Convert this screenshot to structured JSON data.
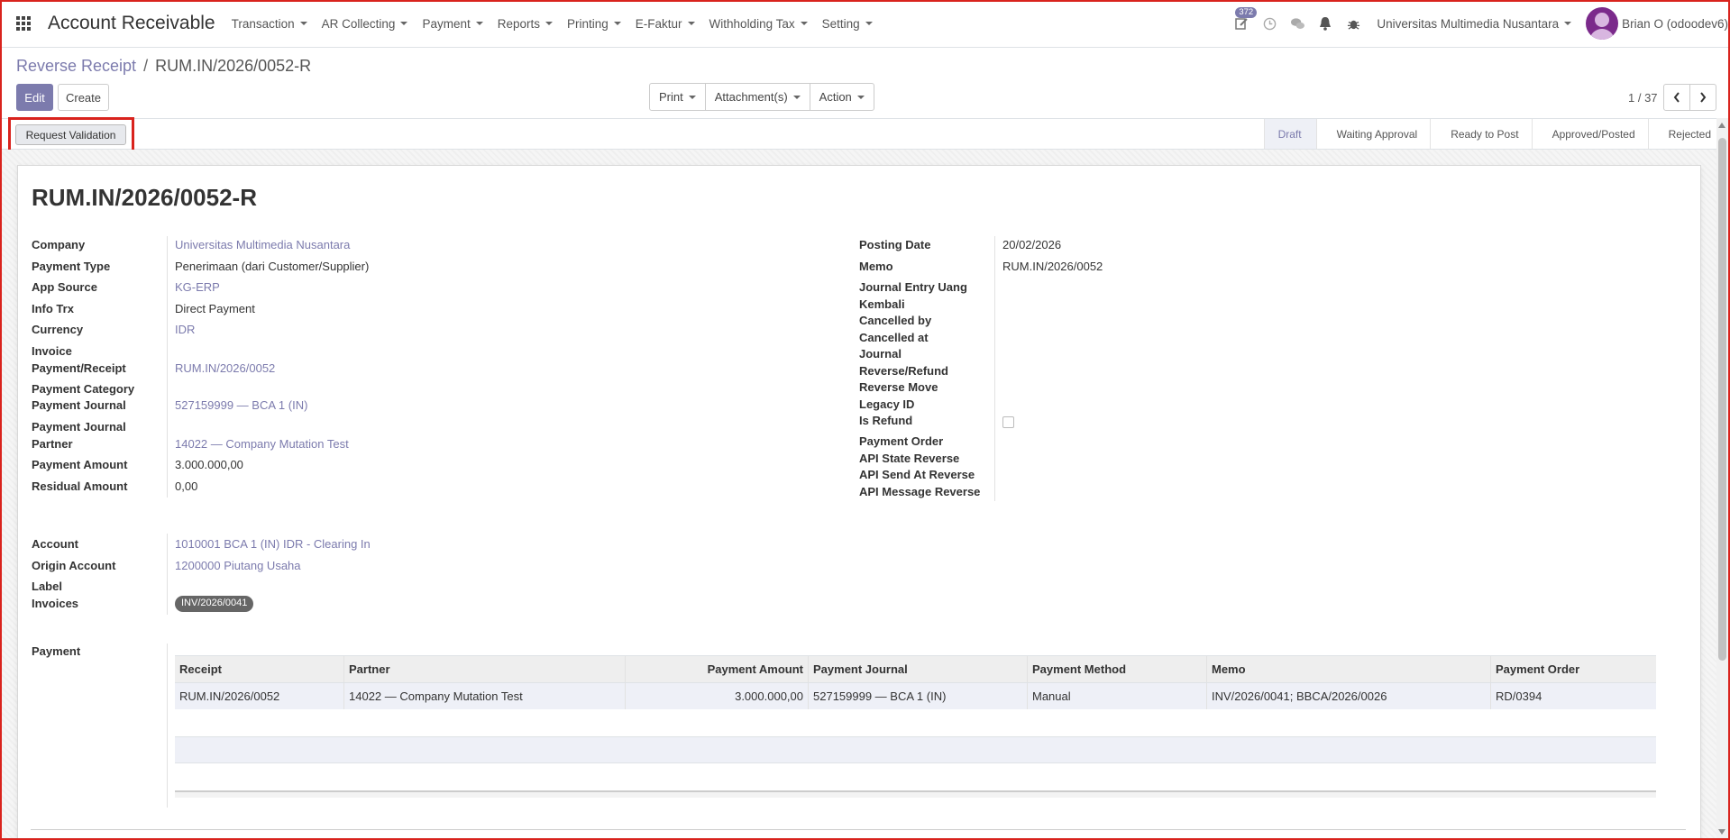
{
  "navbar": {
    "app_title": "Account Receivable",
    "menu": [
      "Transaction",
      "AR Collecting",
      "Payment",
      "Reports",
      "Printing",
      "E-Faktur",
      "Withholding Tax",
      "Setting"
    ],
    "activity_count": "372",
    "company": "Universitas Multimedia Nusantara",
    "user": "Brian O (odoodev6)"
  },
  "control": {
    "breadcrumb_parent": "Reverse Receipt",
    "breadcrumb_sep": "/",
    "breadcrumb_current": "RUM.IN/2026/0052-R",
    "edit_label": "Edit",
    "create_label": "Create",
    "print_label": "Print",
    "attachments_label": "Attachment(s)",
    "action_label": "Action",
    "pager_value": "1 / 37"
  },
  "statusbar": {
    "request_validation": "Request Validation",
    "stages": [
      "Draft",
      "Waiting Approval",
      "Ready to Post",
      "Approved/Posted",
      "Rejected"
    ],
    "active_stage": "Draft"
  },
  "record": {
    "title": "RUM.IN/2026/0052-R",
    "left": [
      {
        "label": "Company",
        "value": "Universitas Multimedia Nusantara",
        "link": true
      },
      {
        "label": "Payment Type",
        "value": "Penerimaan (dari Customer/Supplier)",
        "link": false
      },
      {
        "label": "App Source",
        "value": "KG-ERP",
        "link": true
      },
      {
        "label": "Info Trx",
        "value": "Direct Payment",
        "link": false
      },
      {
        "label": "Currency",
        "value": "IDR",
        "link": true
      },
      {
        "label": "Invoice Payment/Receipt",
        "value": "RUM.IN/2026/0052",
        "link": true
      },
      {
        "label": "Payment Category",
        "value": "",
        "link": false
      },
      {
        "label": "Payment Journal",
        "value": "527159999 — BCA 1 (IN)",
        "link": true
      },
      {
        "label": "Payment Journal Partner",
        "value": "14022 — Company Mutation Test",
        "link": true
      },
      {
        "label": "Payment Amount",
        "value": "3.000.000,00",
        "link": false
      },
      {
        "label": "Residual Amount",
        "value": "0,00",
        "link": false
      }
    ],
    "right": [
      {
        "label": "Posting Date",
        "value": "20/02/2026"
      },
      {
        "label": "Memo",
        "value": "RUM.IN/2026/0052"
      },
      {
        "label": "Journal Entry Uang Kembali",
        "value": ""
      },
      {
        "label": "Cancelled by",
        "value": ""
      },
      {
        "label": "Cancelled at",
        "value": ""
      },
      {
        "label": "Journal Reverse/Refund",
        "value": ""
      },
      {
        "label": "Reverse Move",
        "value": ""
      },
      {
        "label": "Legacy ID",
        "value": ""
      },
      {
        "label": "Is Refund",
        "value": ""
      },
      {
        "label": "Payment Order",
        "value": ""
      },
      {
        "label": "API State Reverse",
        "value": ""
      },
      {
        "label": "API Send At Reverse",
        "value": ""
      },
      {
        "label": "API Message Reverse",
        "value": ""
      }
    ],
    "account_group": [
      {
        "label": "Account",
        "value": "1010001 BCA 1 (IN) IDR - Clearing In",
        "link": true
      },
      {
        "label": "Origin Account",
        "value": "1200000 Piutang Usaha",
        "link": true
      },
      {
        "label": "Label",
        "value": "",
        "link": false
      },
      {
        "label": "Invoices",
        "value": "INV/2026/0041",
        "tag": true
      }
    ],
    "payment_label": "Payment",
    "payment_table": {
      "columns": [
        "Receipt",
        "Partner",
        "Payment Amount",
        "Payment Journal",
        "Payment Method",
        "Memo",
        "Payment Order"
      ],
      "rows": [
        [
          "RUM.IN/2026/0052",
          "14022 — Company Mutation Test",
          "3.000.000,00",
          "527159999 — BCA 1 (IN)",
          "Manual",
          "INV/2026/0041; BBCA/2026/0026",
          "RD/0394"
        ]
      ]
    }
  },
  "colors": {
    "accent": "#7c7bad",
    "highlight": "#d9231d"
  }
}
